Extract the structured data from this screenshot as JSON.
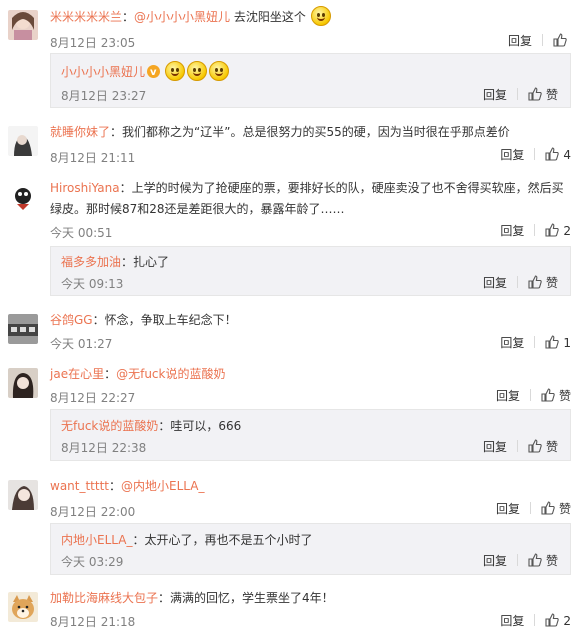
{
  "actions": {
    "reply": "回复",
    "like": "赞"
  },
  "comments": [
    {
      "user": "米米米米米兰",
      "colon": "：",
      "mention": "@小小小小黑妞儿",
      "text": " 去沈阳坐这个",
      "time": "8月12日 23:05",
      "likes": "",
      "replies": [
        {
          "user": "小小小小黑妞儿",
          "colon": "",
          "text": "",
          "time": "8月12日 23:27",
          "likes": ""
        }
      ]
    },
    {
      "user": "就睡你妹了",
      "colon": "：",
      "text": "我们都称之为“辽半”。总是很努力的买55的硬，因为当时很在乎那点差价",
      "time": "8月12日 21:11",
      "likes": "4"
    },
    {
      "user": "HiroshiYana",
      "colon": "：",
      "text": "上学的时候为了抢硬座的票，要排好长的队，硬座卖没了也不舍得买软座，然后买",
      "text2": "绿皮。那时候87和28还是差距很大的，暴露年龄了……",
      "time": "今天 00:51",
      "likes": "2",
      "replies": [
        {
          "user": "福多多加油",
          "colon": "：",
          "text": "扎心了",
          "time": "今天 09:13",
          "likes": ""
        }
      ]
    },
    {
      "user": "谷鸽GG",
      "colon": "：",
      "text": "怀念，争取上车纪念下！",
      "time": "今天 01:27",
      "likes": "1"
    },
    {
      "user": "jae在心里",
      "colon": "：",
      "mention": "@无fuck说的蓝酸奶",
      "text": "",
      "time": "8月12日 22:27",
      "likes": "",
      "replies": [
        {
          "user": "无fuck说的蓝酸奶",
          "colon": "：",
          "text": "哇可以，666",
          "time": "8月12日 22:38",
          "likes": ""
        }
      ]
    },
    {
      "user": "want_ttttt",
      "colon": "：",
      "mention": "@内地小ELLA_",
      "text": "",
      "time": "8月12日 22:00",
      "likes": "",
      "replies": [
        {
          "user": "内地小ELLA_",
          "colon": "：",
          "text": "太开心了，再也不是五个小时了",
          "time": "今天 03:29",
          "likes": ""
        }
      ]
    },
    {
      "user": "加勒比海麻线大包子",
      "colon": "：",
      "text": "满满的回忆，学生票坐了4年！",
      "time": "8月12日 21:18",
      "likes": "2"
    }
  ]
}
